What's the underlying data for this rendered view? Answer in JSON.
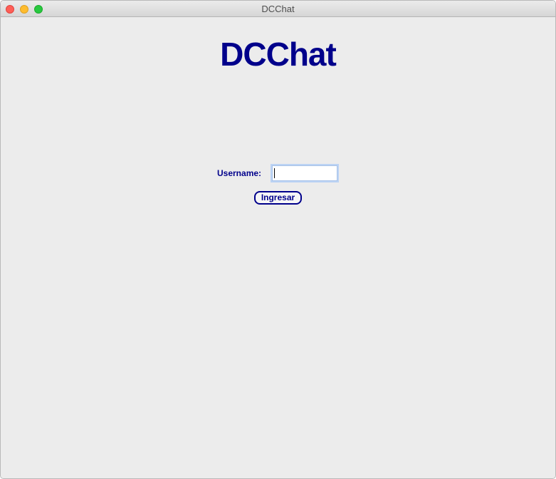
{
  "window": {
    "title": "DCChat"
  },
  "main": {
    "app_title": "DCChat",
    "username_label": "Username:",
    "username_value": "",
    "login_button_label": "Ingresar"
  },
  "colors": {
    "brand": "#00008b",
    "background": "#ececec"
  }
}
